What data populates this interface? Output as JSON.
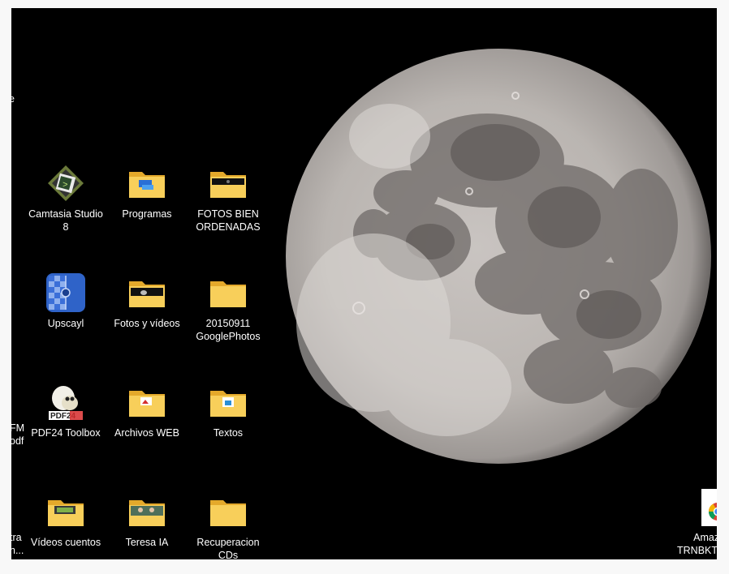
{
  "desktop": {
    "background": "#000000",
    "icons": [
      {
        "id": "camtasia",
        "label_lines": [
          "Camtasia Studio",
          "8"
        ],
        "icon": "camtasia-icon"
      },
      {
        "id": "programas",
        "label_lines": [
          "Programas"
        ],
        "icon": "folder-icon"
      },
      {
        "id": "fotos-bien",
        "label_lines": [
          "FOTOS BIEN",
          "ORDENADAS"
        ],
        "icon": "folder-icon"
      },
      {
        "id": "upscayl",
        "label_lines": [
          "Upscayl"
        ],
        "icon": "upscayl-icon"
      },
      {
        "id": "fotos-videos",
        "label_lines": [
          "Fotos y vídeos"
        ],
        "icon": "folder-icon"
      },
      {
        "id": "googlephotos",
        "label_lines": [
          "20150911",
          "GooglePhotos"
        ],
        "icon": "folder-icon"
      },
      {
        "id": "pdf24",
        "label_lines": [
          "PDF24 Toolbox"
        ],
        "icon": "pdf24-icon"
      },
      {
        "id": "archivos-web",
        "label_lines": [
          "Archivos WEB"
        ],
        "icon": "folder-icon"
      },
      {
        "id": "textos",
        "label_lines": [
          "Textos"
        ],
        "icon": "folder-icon"
      },
      {
        "id": "videos-cuentos",
        "label_lines": [
          "Vídeos cuentos"
        ],
        "icon": "folder-icon"
      },
      {
        "id": "teresa-ia",
        "label_lines": [
          "Teresa IA"
        ],
        "icon": "folder-icon"
      },
      {
        "id": "recuperacion",
        "label_lines": [
          "Recuperacion",
          "CDs"
        ],
        "icon": "folder-icon"
      }
    ],
    "partial_left": {
      "top": "e",
      "mid_1": "FM",
      "mid_2": "odf",
      "bottom_1": "tra",
      "bottom_2": "n..."
    },
    "partial_right": {
      "line_1": "Amazo",
      "line_2": "TRNBKTH"
    },
    "pdf24_badge": "PDF24",
    "colors": {
      "folder": "#f8cf5a",
      "folder_dark": "#e4a92b",
      "label": "#ffffff"
    }
  }
}
